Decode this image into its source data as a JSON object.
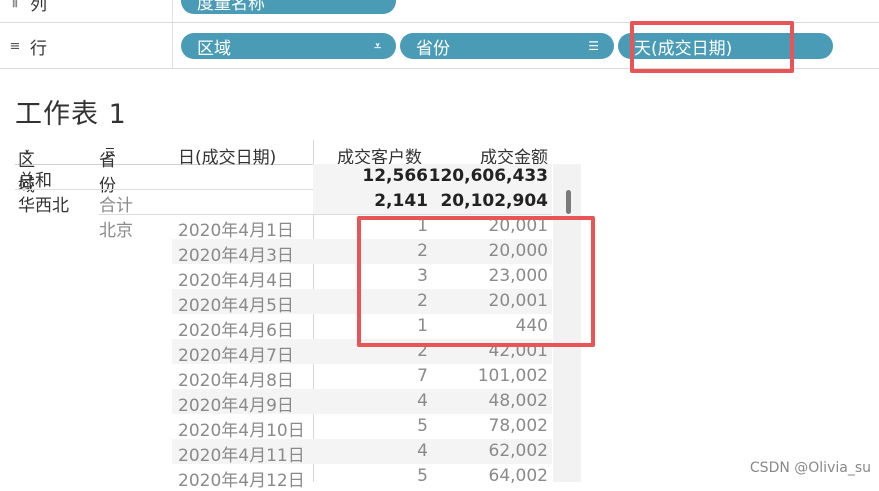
{
  "shelves": {
    "columns": {
      "label": "列",
      "icon": "columns-icon",
      "pill": "度量名称"
    },
    "rows": {
      "label": "行",
      "icon": "rows-icon",
      "pills": [
        {
          "label": "区域",
          "sort_icon": "sort-icon"
        },
        {
          "label": "省份",
          "sort_icon": "sort-icon"
        },
        {
          "label": "天(成交日期)"
        }
      ]
    }
  },
  "sheet": {
    "title": "工作表 1"
  },
  "table": {
    "headers": [
      "区域",
      "省份",
      "日(成交日期)",
      "成交客户数",
      "成交金额"
    ],
    "grand_total": {
      "label": "总和",
      "customers": "12,566",
      "amount": "120,606,433"
    },
    "region": {
      "name": "华西北",
      "subtotal_label": "合计",
      "customers": "2,141",
      "amount": "20,102,904"
    },
    "province": "北京",
    "rows": [
      {
        "date": "2020年4月1日",
        "customers": "1",
        "amount": "20,001"
      },
      {
        "date": "2020年4月3日",
        "customers": "2",
        "amount": "20,000"
      },
      {
        "date": "2020年4月4日",
        "customers": "3",
        "amount": "23,000"
      },
      {
        "date": "2020年4月5日",
        "customers": "2",
        "amount": "20,001"
      },
      {
        "date": "2020年4月6日",
        "customers": "1",
        "amount": "440"
      },
      {
        "date": "2020年4月7日",
        "customers": "2",
        "amount": "42,001"
      },
      {
        "date": "2020年4月8日",
        "customers": "7",
        "amount": "101,002"
      },
      {
        "date": "2020年4月9日",
        "customers": "4",
        "amount": "48,002"
      },
      {
        "date": "2020年4月10日",
        "customers": "5",
        "amount": "78,002"
      },
      {
        "date": "2020年4月11日",
        "customers": "4",
        "amount": "62,002"
      },
      {
        "date": "2020年4月12日",
        "customers": "5",
        "amount": "64,002"
      }
    ]
  },
  "colors": {
    "pill": "#4a9bb6",
    "highlight": "#e95557"
  },
  "watermark": "CSDN @Olivia_su"
}
